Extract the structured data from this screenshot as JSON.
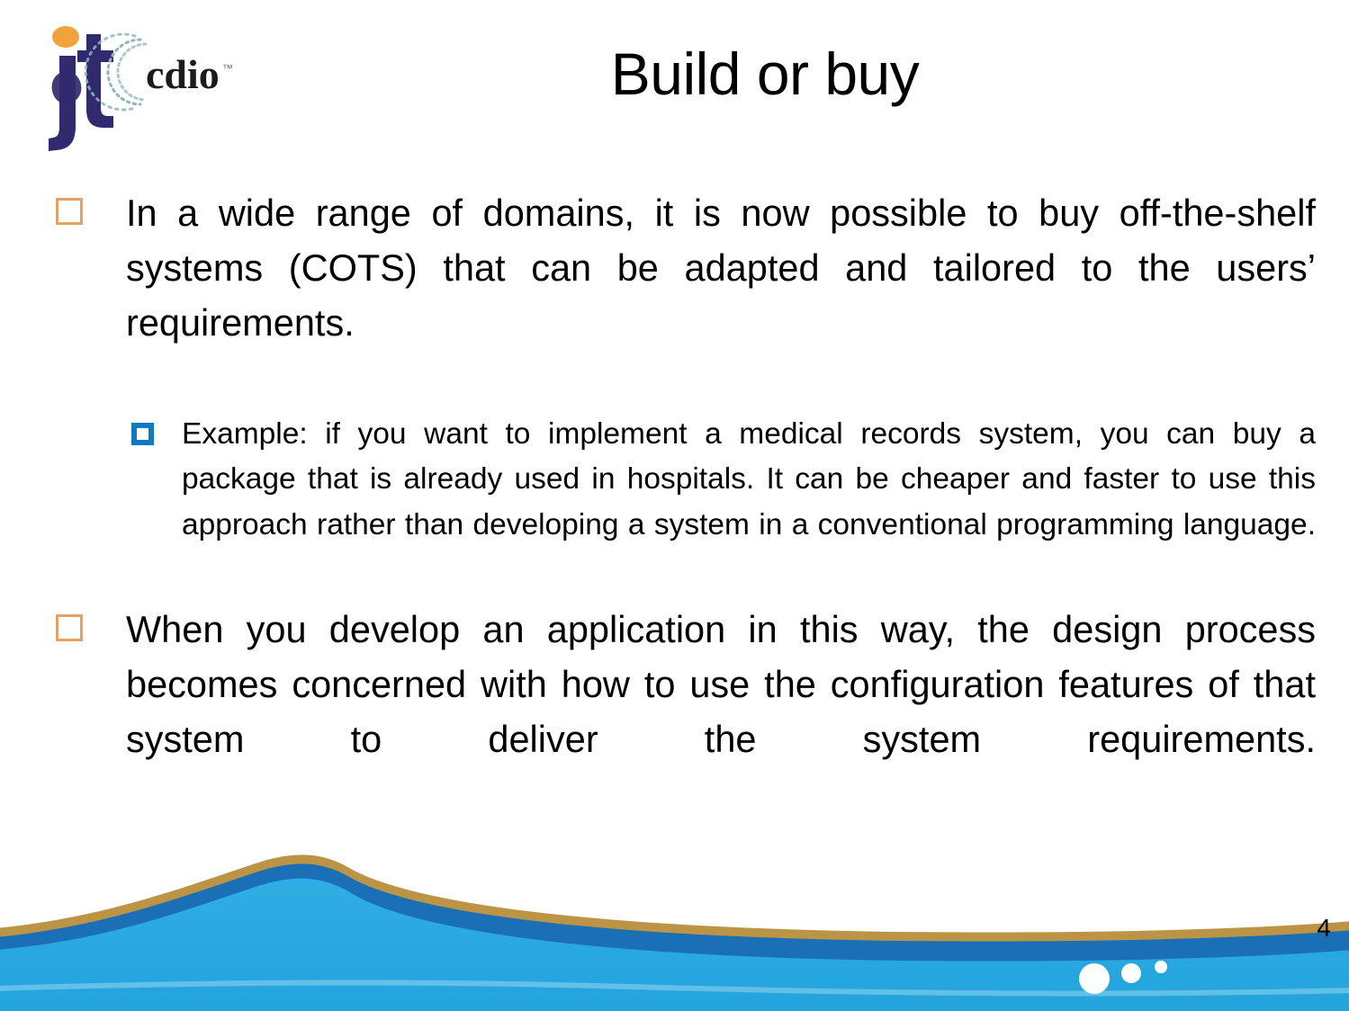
{
  "slide": {
    "title": "Build or buy",
    "page_number": "4",
    "colors": {
      "bullet_level1": "#E3A264",
      "bullet_level2": "#1179BE",
      "wave_light_blue": "#29A8DF",
      "wave_dark_blue": "#1B6FB5",
      "wave_gold": "#C19A4B",
      "logo_purple": "#312A6E",
      "logo_orange": "#F2A23C",
      "logo_arc_teal": "#8FB7B8",
      "text": "#000000"
    }
  },
  "logo": {
    "wordmark": "cdio",
    "monogram_alt": "jt"
  },
  "content": {
    "bullets": [
      {
        "level": 1,
        "marker": "hollow-square-orange",
        "text": "In a wide range of domains, it is now possible to buy off-the-shelf systems (COTS) that can be adapted and tailored to the users’ requirements."
      },
      {
        "level": 2,
        "marker": "blue-square-outline",
        "text": "Example: if you want to implement a medical records system, you can buy a package that is already used in hospitals. It can be cheaper and faster to use this approach rather than developing a system in a conventional programming language."
      },
      {
        "level": 1,
        "marker": "hollow-square-orange",
        "text": "When you develop an application in this way, the design process becomes concerned with how to use the configuration features of that system to deliver the system requirements."
      }
    ]
  }
}
